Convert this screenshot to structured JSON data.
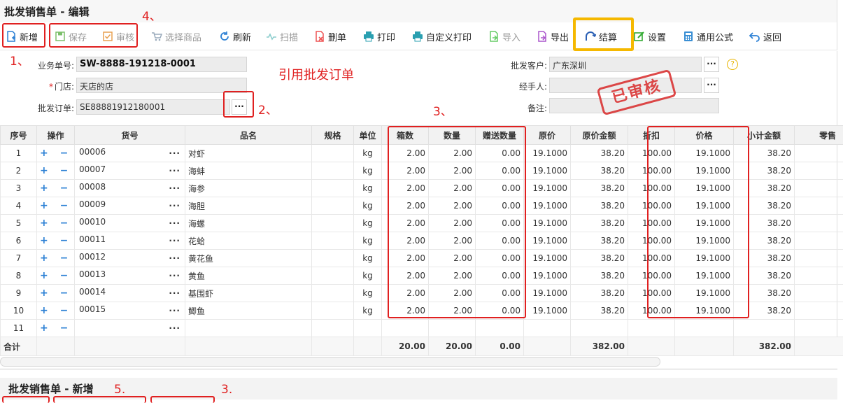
{
  "window_title": "批发销售单 - 编辑",
  "toolbar": {
    "new": "新增",
    "save": "保存",
    "audit": "审核",
    "select_goods": "选择商品",
    "refresh": "刷新",
    "scan": "扫描",
    "delete": "删单",
    "print": "打印",
    "custom_print": "自定义打印",
    "import": "导入",
    "export": "导出",
    "settle": "结算",
    "settings": "设置",
    "formula": "通用公式",
    "back": "返回"
  },
  "annotations": {
    "a1": "1、",
    "a2": "2、",
    "a3": "3、",
    "a4": "4、",
    "a5": "5.",
    "a3b": "3.",
    "ref_order": "引用批发订单"
  },
  "form": {
    "biz_no_label": "业务单号:",
    "biz_no": "SW-8888-191218-0001",
    "store_label": "门店:",
    "store_required": "*",
    "store": "天店的店",
    "order_label": "批发订单:",
    "order": "SE88881912180001",
    "customer_label": "批发客户:",
    "customer": "广东深圳",
    "handler_label": "经手人:",
    "handler": "",
    "remark_label": "备注:",
    "remark": "",
    "dots": "···",
    "help": "?",
    "stamp": "已审核"
  },
  "grid": {
    "headers": [
      "序号",
      "操作",
      "货号",
      "品名",
      "规格",
      "单位",
      "箱数",
      "数量",
      "赠送数量",
      "原价",
      "原价金额",
      "折扣",
      "价格",
      "小计金额",
      "零售"
    ],
    "rows": [
      {
        "no": "1",
        "code": "00006",
        "name": "对虾",
        "spec": "",
        "unit": "kg",
        "boxes": "2.00",
        "qty": "2.00",
        "gift": "0.00",
        "price": "19.1000",
        "amount": "38.20",
        "discount": "100.00",
        "sale_price": "19.1000",
        "subtotal": "38.20"
      },
      {
        "no": "2",
        "code": "00007",
        "name": "海蚌",
        "spec": "",
        "unit": "kg",
        "boxes": "2.00",
        "qty": "2.00",
        "gift": "0.00",
        "price": "19.1000",
        "amount": "38.20",
        "discount": "100.00",
        "sale_price": "19.1000",
        "subtotal": "38.20"
      },
      {
        "no": "3",
        "code": "00008",
        "name": "海参",
        "spec": "",
        "unit": "kg",
        "boxes": "2.00",
        "qty": "2.00",
        "gift": "0.00",
        "price": "19.1000",
        "amount": "38.20",
        "discount": "100.00",
        "sale_price": "19.1000",
        "subtotal": "38.20"
      },
      {
        "no": "4",
        "code": "00009",
        "name": "海胆",
        "spec": "",
        "unit": "kg",
        "boxes": "2.00",
        "qty": "2.00",
        "gift": "0.00",
        "price": "19.1000",
        "amount": "38.20",
        "discount": "100.00",
        "sale_price": "19.1000",
        "subtotal": "38.20"
      },
      {
        "no": "5",
        "code": "00010",
        "name": "海螺",
        "spec": "",
        "unit": "kg",
        "boxes": "2.00",
        "qty": "2.00",
        "gift": "0.00",
        "price": "19.1000",
        "amount": "38.20",
        "discount": "100.00",
        "sale_price": "19.1000",
        "subtotal": "38.20"
      },
      {
        "no": "6",
        "code": "00011",
        "name": "花蛤",
        "spec": "",
        "unit": "kg",
        "boxes": "2.00",
        "qty": "2.00",
        "gift": "0.00",
        "price": "19.1000",
        "amount": "38.20",
        "discount": "100.00",
        "sale_price": "19.1000",
        "subtotal": "38.20"
      },
      {
        "no": "7",
        "code": "00012",
        "name": "黄花鱼",
        "spec": "",
        "unit": "kg",
        "boxes": "2.00",
        "qty": "2.00",
        "gift": "0.00",
        "price": "19.1000",
        "amount": "38.20",
        "discount": "100.00",
        "sale_price": "19.1000",
        "subtotal": "38.20"
      },
      {
        "no": "8",
        "code": "00013",
        "name": "黄鱼",
        "spec": "",
        "unit": "kg",
        "boxes": "2.00",
        "qty": "2.00",
        "gift": "0.00",
        "price": "19.1000",
        "amount": "38.20",
        "discount": "100.00",
        "sale_price": "19.1000",
        "subtotal": "38.20"
      },
      {
        "no": "9",
        "code": "00014",
        "name": "基围虾",
        "spec": "",
        "unit": "kg",
        "boxes": "2.00",
        "qty": "2.00",
        "gift": "0.00",
        "price": "19.1000",
        "amount": "38.20",
        "discount": "100.00",
        "sale_price": "19.1000",
        "subtotal": "38.20"
      },
      {
        "no": "10",
        "code": "00015",
        "name": "鲫鱼",
        "spec": "",
        "unit": "kg",
        "boxes": "2.00",
        "qty": "2.00",
        "gift": "0.00",
        "price": "19.1000",
        "amount": "38.20",
        "discount": "100.00",
        "sale_price": "19.1000",
        "subtotal": "38.20"
      },
      {
        "no": "11",
        "code": "",
        "name": "",
        "spec": "",
        "unit": "",
        "boxes": "",
        "qty": "",
        "gift": "",
        "price": "",
        "amount": "",
        "discount": "",
        "sale_price": "",
        "subtotal": ""
      }
    ],
    "row_ops": "+ −",
    "row_dots": "···",
    "total": {
      "label": "合计",
      "boxes": "20.00",
      "qty": "20.00",
      "gift": "0.00",
      "amount": "382.00",
      "subtotal": "382.00"
    }
  },
  "second_window_title": "批发销售单 - 新增",
  "colors": {
    "annotation_red": "#e02020",
    "highlight_yellow": "#f5b800",
    "icon_blue": "#2a7fd4"
  }
}
